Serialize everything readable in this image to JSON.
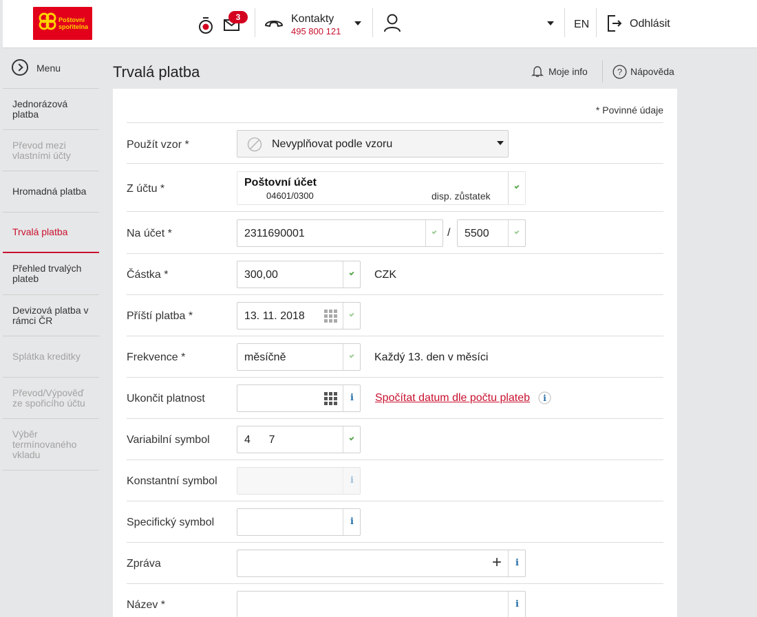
{
  "header": {
    "logo_text_line1": "Poštovní",
    "logo_text_line2": "spořitelna",
    "notifications_count": "3",
    "contacts_label": "Kontakty",
    "contacts_phone": "495 800 121",
    "language": "EN",
    "logout_label": "Odhlásit",
    "icons": [
      "timer-icon",
      "mail-icon",
      "phone-icon",
      "user-icon",
      "logout-icon"
    ]
  },
  "sidebar": {
    "menu_label": "Menu",
    "items": [
      {
        "label": "Jednorázová platba",
        "state": "normal"
      },
      {
        "label": "Převod mezi vlastními účty",
        "state": "disabled"
      },
      {
        "label": "Hromadná platba",
        "state": "normal"
      },
      {
        "label": "Trvalá platba",
        "state": "active"
      },
      {
        "label": "Přehled trvalých plateb",
        "state": "normal"
      },
      {
        "label": "Devizová platba v rámci ČR",
        "state": "normal"
      },
      {
        "label": "Splátka kreditky",
        "state": "disabled"
      },
      {
        "label": "Převod/Výpověď ze spořicího účtu",
        "state": "disabled"
      },
      {
        "label": "Výběr termínovaného vkladu",
        "state": "disabled"
      }
    ]
  },
  "page": {
    "title": "Trvalá platba",
    "moje_info": "Moje info",
    "napoveda": "Nápověda",
    "required_note": "* Povinné údaje"
  },
  "form": {
    "template": {
      "label": "Použít vzor *",
      "value": "Nevyplňovat podle vzoru"
    },
    "from_account": {
      "label": "Z účtu *",
      "name": "Poštovní účet",
      "number": "04601/0300",
      "balance_label": "disp. zůstatek"
    },
    "to_account": {
      "label": "Na účet *",
      "number": "2311690001",
      "separator": "/",
      "bank_code": "5500"
    },
    "amount": {
      "label": "Částka *",
      "value": "300,00",
      "currency": "CZK"
    },
    "next_payment": {
      "label": "Příští platba *",
      "value": "13. 11. 2018"
    },
    "frequency": {
      "label": "Frekvence *",
      "value": "měsíčně",
      "description": "Každý 13. den v měsíci"
    },
    "end_validity": {
      "label": "Ukončit platnost",
      "value": "",
      "link": "Spočítat datum dle počtu plateb"
    },
    "variable_symbol": {
      "label": "Variabilní symbol",
      "value": "4      7"
    },
    "constant_symbol": {
      "label": "Konstantní symbol",
      "value": ""
    },
    "specific_symbol": {
      "label": "Specifický symbol",
      "value": ""
    },
    "message": {
      "label": "Zpráva",
      "value": ""
    },
    "name": {
      "label": "Název *",
      "value": ""
    },
    "info_glyph": "i"
  },
  "colors": {
    "brand_red": "#c8102e",
    "logo_red": "#e2001a",
    "logo_yellow": "#ffd200",
    "check_green": "#5aa64f",
    "info_blue": "#1f6aa5",
    "background": "#e6e7e8"
  }
}
